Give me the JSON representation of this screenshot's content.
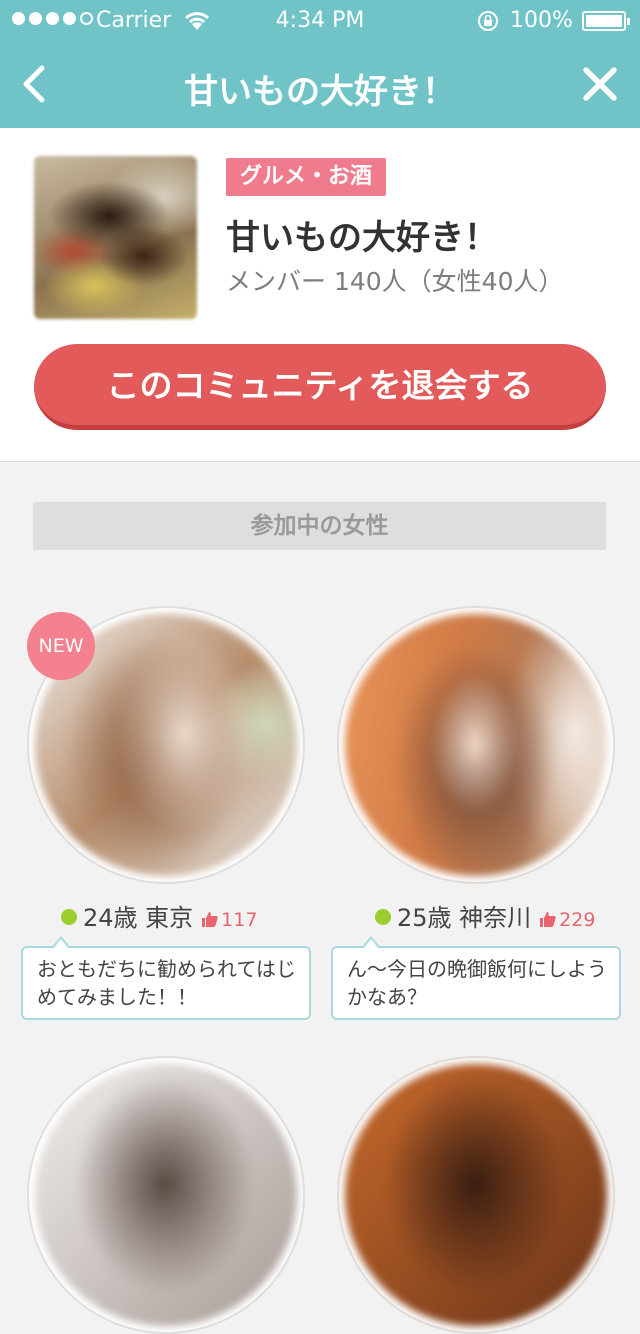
{
  "status_bar": {
    "carrier": "Carrier",
    "time": "4:34 PM",
    "battery": "100%"
  },
  "nav": {
    "title": "甘いもの大好き！",
    "back_icon": "chevron-left-icon",
    "close_icon": "close-icon"
  },
  "community": {
    "category": "グルメ・お酒",
    "name": "甘いもの大好き！",
    "members": "メンバー 140人（女性40人）",
    "leave_label": "このコミュニティを退会する"
  },
  "members_section": {
    "header": "参加中の女性",
    "cards": [
      {
        "badge": "NEW",
        "age_location": "24歳 東京",
        "likes": "117",
        "message": "おともだちに勧められてはじめてみました！！"
      },
      {
        "badge": "",
        "age_location": "25歳 神奈川",
        "likes": "229",
        "message": "ん〜今日の晩御飯何にしようかなあ？"
      }
    ]
  },
  "colors": {
    "nav_bg": "#70c3c7",
    "category_bg": "#f07b8c",
    "leave_button": "#e25a5a",
    "online_dot": "#9ccd2e",
    "likes": "#e8646e",
    "bubble_border": "#a9d8dd"
  }
}
